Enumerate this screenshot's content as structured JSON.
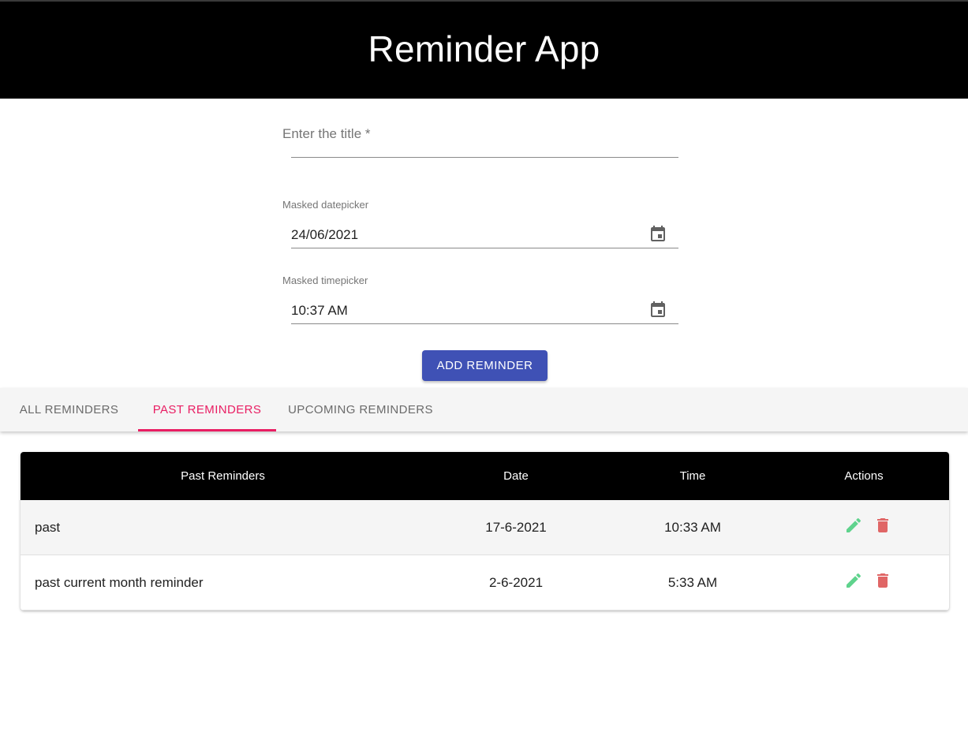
{
  "app": {
    "title": "Reminder App"
  },
  "form": {
    "title_field": {
      "label": "Enter the title *",
      "value": ""
    },
    "date_field": {
      "label": "Masked datepicker",
      "value": "24/06/2021",
      "icon": "calendar-icon"
    },
    "time_field": {
      "label": "Masked timepicker",
      "value": "10:37 AM",
      "icon": "calendar-icon"
    },
    "submit_label": "ADD REMINDER"
  },
  "tabs": [
    {
      "label": "ALL REMINDERS",
      "active": false
    },
    {
      "label": "PAST REMINDERS",
      "active": true
    },
    {
      "label": "UPCOMING REMINDERS",
      "active": false
    }
  ],
  "table": {
    "headers": [
      "Past Reminders",
      "Date",
      "Time",
      "Actions"
    ],
    "rows": [
      {
        "title": "past",
        "date": "17-6-2021",
        "time": "10:33 AM"
      },
      {
        "title": "past current month reminder",
        "date": "2-6-2021",
        "time": "5:33 AM"
      }
    ]
  },
  "colors": {
    "header_bg": "#000000",
    "primary_button": "#3f51b5",
    "active_tab": "#e91e63",
    "edit_icon": "#5fd38d",
    "delete_icon": "#e06666"
  },
  "icons": {
    "edit": "pencil-icon",
    "delete": "trash-icon",
    "picker": "calendar-icon"
  }
}
